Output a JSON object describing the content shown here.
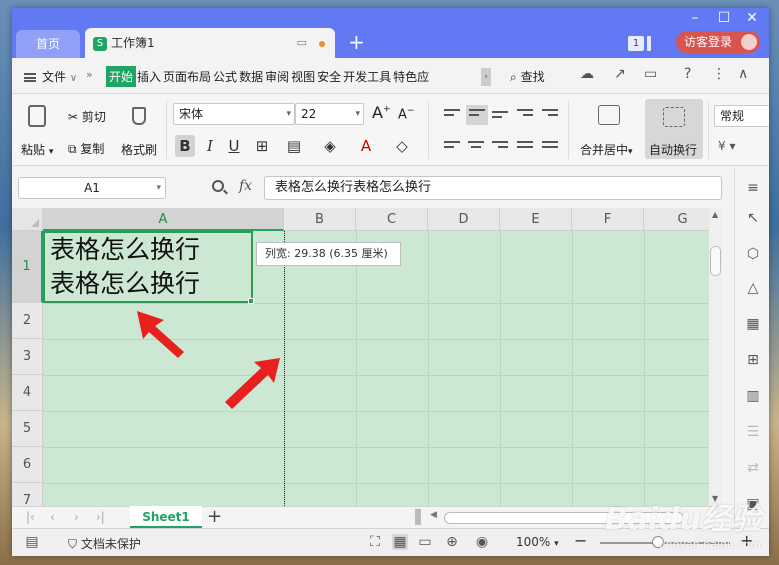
{
  "titlebar": {
    "home_tab": "首页",
    "doc_tab": "工作簿1",
    "doc_logo": "S",
    "badge": "1",
    "guest_label": "访客登录"
  },
  "menu": {
    "file": "文件",
    "tabs": [
      "开始",
      "插入",
      "页面布局",
      "公式",
      "数据",
      "审阅",
      "视图",
      "安全",
      "开发工具",
      "特色应"
    ],
    "active_tab": "开始",
    "search": "查找"
  },
  "ribbon": {
    "paste": "粘贴",
    "cut": "剪切",
    "copy": "复制",
    "format_painter": "格式刷",
    "font_name": "宋体",
    "font_size": "22",
    "merge_center": "合并居中",
    "auto_wrap": "自动换行",
    "number_format": "常规",
    "bold": "B",
    "italic": "I",
    "underline": "U",
    "increase_font": "A",
    "decrease_font": "A"
  },
  "formula_bar": {
    "name_box": "A1",
    "fx": "fx",
    "content": "表格怎么换行表格怎么换行"
  },
  "grid": {
    "columns": [
      "A",
      "B",
      "C",
      "D",
      "E",
      "F",
      "G"
    ],
    "selected_column": "A",
    "rows": [
      "1",
      "2",
      "3",
      "4",
      "5",
      "6",
      "7"
    ],
    "selected_row": "1",
    "cell_a1": "表格怎么换行\n表格怎么换行",
    "tooltip": "列宽: 29.38 (6.35 厘米)"
  },
  "sheets": {
    "active": "Sheet1",
    "add": "+"
  },
  "status": {
    "protection": "文档未保护",
    "zoom": "100%"
  },
  "watermark": {
    "brand": "Baidu经验",
    "url": "jingyan.baidu.com"
  },
  "colors": {
    "title_bar": "#6279f4",
    "accent_green": "#1fa463",
    "grid_bg": "#cde8d2",
    "annotation_red": "#e8201e"
  }
}
